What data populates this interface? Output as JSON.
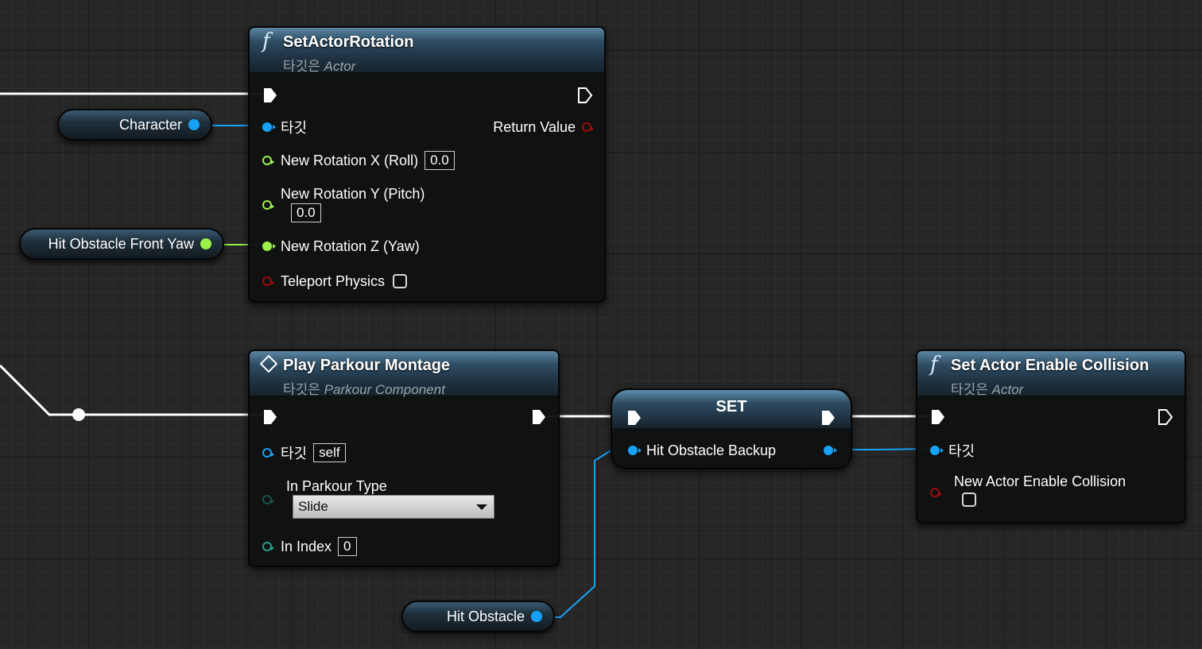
{
  "nodes": {
    "set_actor_rotation": {
      "title": "SetActorRotation",
      "subtitle_prefix": "타깃은",
      "subtitle_type": "Actor",
      "pin_target": "타깃",
      "pin_return": "Return Value",
      "pin_roll": "New Rotation X (Roll)",
      "pin_roll_value": "0.0",
      "pin_pitch": "New Rotation Y (Pitch)",
      "pin_pitch_value": "0.0",
      "pin_yaw": "New Rotation Z (Yaw)",
      "pin_teleport": "Teleport Physics"
    },
    "play_parkour_montage": {
      "title": "Play Parkour Montage",
      "subtitle_prefix": "타깃은",
      "subtitle_type": "Parkour Component",
      "pin_target": "타깃",
      "pin_target_value": "self",
      "pin_type": "In Parkour Type",
      "pin_type_value": "Slide",
      "pin_index": "In Index",
      "pin_index_value": "0"
    },
    "set": {
      "title": "SET",
      "pin_var": "Hit Obstacle Backup"
    },
    "set_actor_enable_collision": {
      "title": "Set Actor Enable Collision",
      "subtitle_prefix": "타깃은",
      "subtitle_type": "Actor",
      "pin_target": "타깃",
      "pin_enable": "New Actor Enable Collision"
    }
  },
  "variables": {
    "character": "Character",
    "hit_obstacle_front_yaw": "Hit Obstacle Front Yaw",
    "hit_obstacle": "Hit Obstacle"
  },
  "colors": {
    "object_pin": "#17a2f7",
    "float_pin": "#9cf14b",
    "bool_pin": "#a00b0b",
    "byte_pin": "#17554f",
    "int_pin": "#23a08c",
    "exec_wire": "#ffffff"
  }
}
